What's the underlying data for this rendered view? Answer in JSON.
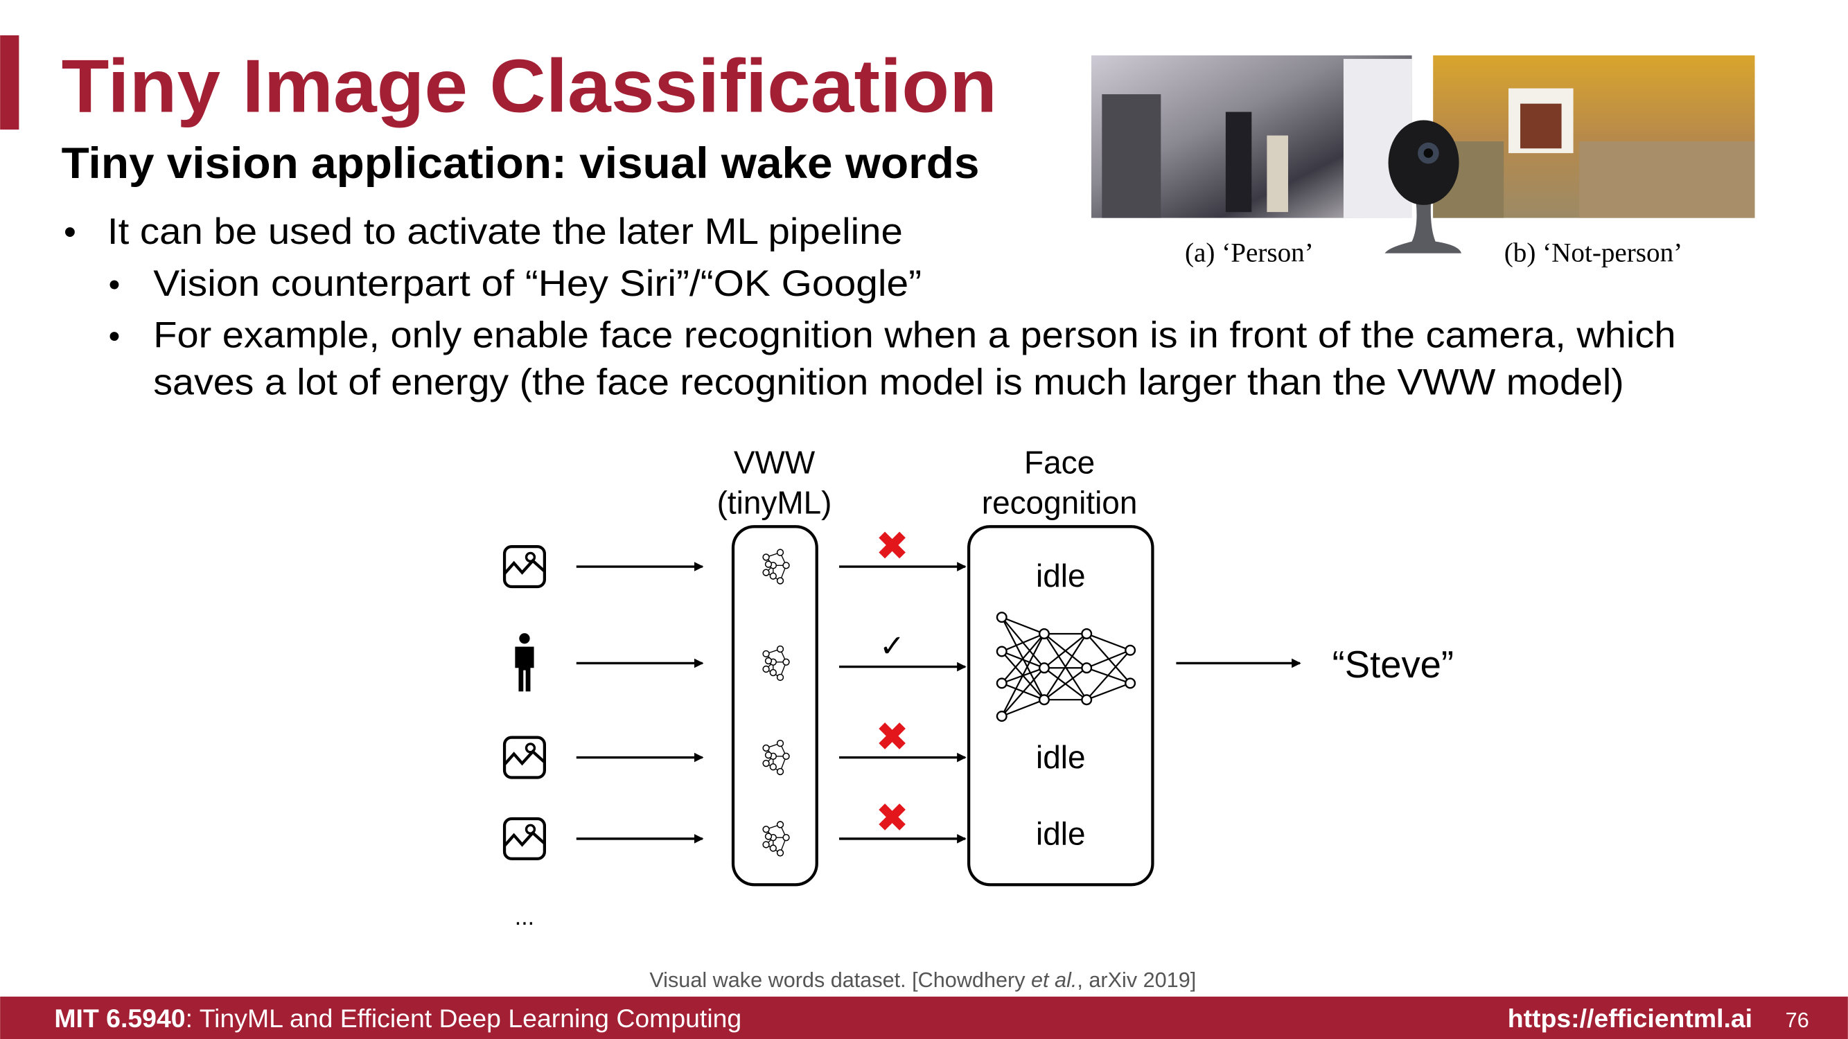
{
  "slide": {
    "title": "Tiny Image Classification",
    "subtitle": "Tiny vision application: visual wake words",
    "bullets": [
      "It can be used to activate the later ML pipeline",
      "Vision counterpart of “Hey Siri”/“OK Google”",
      "For example, only enable face recognition when a person is in front of the camera, which",
      "saves a lot of energy (the face recognition model is much larger than the VWW model)"
    ],
    "bullet_glyph": "•"
  },
  "figure": {
    "caption_a": "(a) ‘Person’",
    "caption_b": "(b) ‘Not-person’"
  },
  "diagram": {
    "vww_label_1": "VWW",
    "vww_label_2": "(tinyML)",
    "face_label_1": "Face",
    "face_label_2": "recognition",
    "rows": [
      {
        "input": "image-icon",
        "decision": "✖",
        "state": "idle"
      },
      {
        "input": "person-icon",
        "decision": "✓",
        "state": ""
      },
      {
        "input": "image-icon",
        "decision": "✖",
        "state": "idle"
      },
      {
        "input": "image-icon",
        "decision": "✖",
        "state": "idle"
      }
    ],
    "output": "“Steve”",
    "ellipsis": "...",
    "reject_color": "#e3161b"
  },
  "citation": {
    "pre": "Visual wake words dataset. [Chowdhery ",
    "italic": "et al.",
    "post": ", arXiv 2019]"
  },
  "footer": {
    "course_code": "MIT 6.5940",
    "course_name": ": TinyML and Efficient Deep Learning Computing",
    "url": "https://efficientml.ai",
    "page_number": "76",
    "color": "#a31f34"
  }
}
